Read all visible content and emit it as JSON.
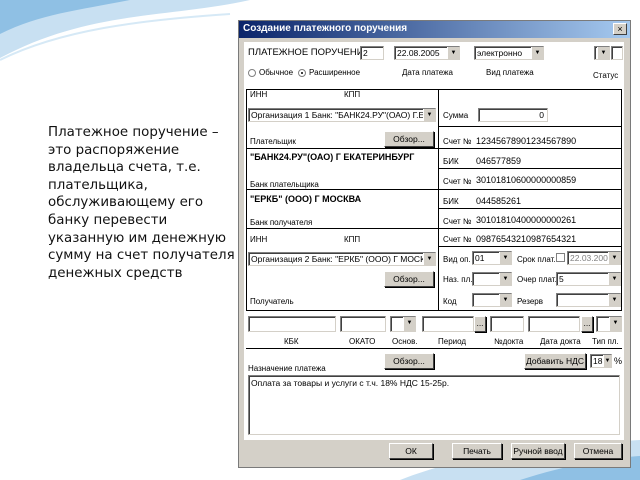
{
  "slide": {
    "text": "Платежное поручение – это распоряжение владельца счета, т.е. плательщика, обслуживающему его банку перевести указанную им денежную сумму на счет получателя денежных средств"
  },
  "window": {
    "title": "Создание платежного поручения",
    "close_glyph": "×"
  },
  "header": {
    "doc_title": "ПЛАТЕЖНОЕ ПОРУЧЕНИЕ №",
    "doc_number": "2",
    "date": "22.08.2005",
    "payment_type": "электронно",
    "status": "",
    "radio_normal": "Обычное",
    "radio_extended": "Расширенное",
    "date_label": "Дата платежа",
    "type_label": "Вид платежа",
    "status_label": "Статус"
  },
  "payer": {
    "inn_label": "ИНН",
    "kpp_label": "КПП",
    "org_combo": "Организация 1   Банк: \"БАНК24.РУ\"(ОАО) Г.ЕКА",
    "sum_label": "Сумма",
    "sum_value": "0",
    "browse_label": "Обзор...",
    "payer_label": "Плательщик",
    "account_label": "Счет №",
    "account_value": "12345678901234567890",
    "bank_name": "\"БАНК24.РУ\"(ОАО) Г ЕКАТЕРИНБУРГ",
    "bik_label": "БИК",
    "bik_value": "046577859",
    "corr_label": "Счет №",
    "corr_value": "30101810600000000859",
    "bank_label": "Банк плательщика"
  },
  "payee_bank": {
    "bank_name": "\"ЕРКБ\" (ООО) Г МОСКВА",
    "bik_label": "БИК",
    "bik_value": "044585261",
    "corr_label": "Счет №",
    "corr_value": "30101810400000000261",
    "bank_label": "Банк получателя"
  },
  "payee": {
    "inn_label": "ИНН",
    "kpp_label": "КПП",
    "account_label": "Счет №",
    "account_value": "09876543210987654321",
    "org_combo": "Организация 2   Банк: \"ЕРКБ\" (ООО) Г МОСКВА",
    "browse_label": "Обзор...",
    "payee_label": "Получатель",
    "op_type_label": "Вид оп.",
    "op_type_value": "01",
    "purpose_code_label": "Наз. пл.",
    "code_label": "Код",
    "term_label": "Срок плат.",
    "term_value": "22.03.2005",
    "priority_label": "Очер плат.",
    "priority_value": "5",
    "reserve_label": "Резерв"
  },
  "tax": {
    "ellipsis": "...",
    "labels": [
      "КБК",
      "ОКАТО",
      "Основ.",
      "Период",
      "№докта",
      "Дата докта",
      "Тип пл."
    ]
  },
  "purpose": {
    "label": "Назначение платежа",
    "browse_label": "Обзор...",
    "vat_button": "Добавить НДС",
    "vat_rate": "18",
    "percent": "%",
    "text": "Оплата за товары и услуги с т.ч. 18% НДС 15-25р."
  },
  "footer": {
    "ok": "ОК",
    "print": "Печать",
    "manual": "Ручной ввод",
    "cancel": "Отмена"
  },
  "colors": {
    "title_bar": "#0a246a",
    "window_face": "#d4d0c8",
    "slide_accent": "#7fb6dc"
  }
}
